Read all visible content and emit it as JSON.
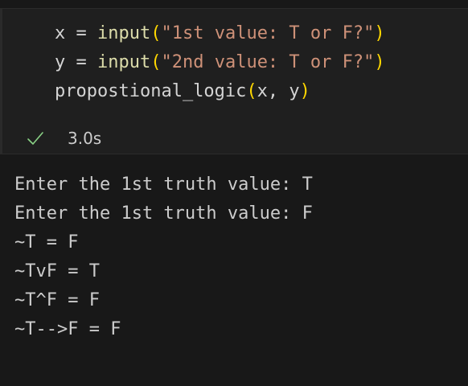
{
  "code_cell": {
    "lines": [
      {
        "var": "x",
        "op": " = ",
        "fn": "input",
        "open": "(",
        "str": "\"1st value: T or F?\"",
        "close": ")"
      },
      {
        "var": "y",
        "op": " = ",
        "fn": "input",
        "open": "(",
        "str": "\"2nd value: T or F?\"",
        "close": ")"
      },
      {
        "fn": "propostional_logic",
        "open": "(",
        "args": "x, y",
        "close": ")"
      }
    ],
    "status": {
      "icon": "check-icon",
      "duration": "3.0s",
      "color": "#89d185"
    }
  },
  "output": {
    "lines": [
      "Enter the 1st truth value: T",
      "Enter the 1st truth value: F",
      "~T = F",
      "~TvF = T",
      "~T^F = F",
      "~T-->F = F"
    ]
  }
}
